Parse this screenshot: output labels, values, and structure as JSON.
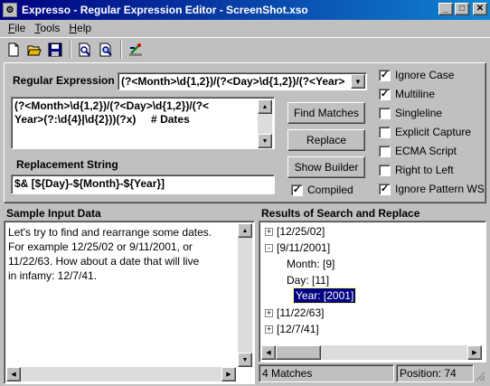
{
  "window": {
    "title": "Expresso - Regular Expression Editor - ScreenShot.xso"
  },
  "menu": [
    {
      "label": "File",
      "key": "F",
      "rest": "ile"
    },
    {
      "label": "Tools",
      "key": "T",
      "rest": "ools"
    },
    {
      "label": "Help",
      "key": "H",
      "rest": "elp"
    }
  ],
  "regex": {
    "label": "Regular Expression",
    "label_key": "E",
    "dropdown_value": "(?<Month>\\d{1,2})/(?<Day>\\d{1,2})/(?<Year>",
    "editor_lines": [
      "(?<Month>\\d{1,2})/(?<Day>\\d{1,2})/(?<",
      "Year>(?:\\d{4}|\\d{2}))(?x)     # Dates"
    ]
  },
  "replacement": {
    "label": "Replacement String",
    "value": "$& [${Day}-${Month}-${Year}]"
  },
  "buttons": {
    "find": "Find Matches",
    "replace": "Replace",
    "builder": "Show Builder"
  },
  "compiled": {
    "label": "Compiled",
    "checked": true
  },
  "options": [
    {
      "label": "Ignore Case",
      "checked": true
    },
    {
      "label": "Multiline",
      "checked": true
    },
    {
      "label": "Singleline",
      "checked": false
    },
    {
      "label": "Explicit Capture",
      "checked": false
    },
    {
      "label": "ECMA Script",
      "checked": false
    },
    {
      "label": "Right to Left",
      "checked": false
    },
    {
      "label": "Ignore Pattern WS",
      "checked": true
    }
  ],
  "sample": {
    "header": "Sample Input Data",
    "lines": [
      "Let's try to find and rearrange some dates.",
      "For example 12/25/02 or 9/11/2001, or",
      "11/22/63. How about a date that will live",
      "in infamy: 12/7/41."
    ]
  },
  "results": {
    "header": "Results of Search and Replace",
    "tree": [
      {
        "label": "[12/25/02]",
        "level": 0,
        "expander": "+"
      },
      {
        "label": "[9/11/2001]",
        "level": 0,
        "expander": "-"
      },
      {
        "label": "Month: [9]",
        "level": 1,
        "expander": ""
      },
      {
        "label": "Day: [11]",
        "level": 1,
        "expander": ""
      },
      {
        "label": "Year: [2001]",
        "level": 1,
        "expander": "",
        "selected": true
      },
      {
        "label": "[11/22/63]",
        "level": 0,
        "expander": "+"
      },
      {
        "label": "[12/7/41]",
        "level": 0,
        "expander": "+"
      }
    ]
  },
  "status": {
    "matches": "4 Matches",
    "position": "Position: 74"
  },
  "colors": {
    "title_start": "#000080",
    "title_end": "#1084d0",
    "selection": "#000080"
  }
}
